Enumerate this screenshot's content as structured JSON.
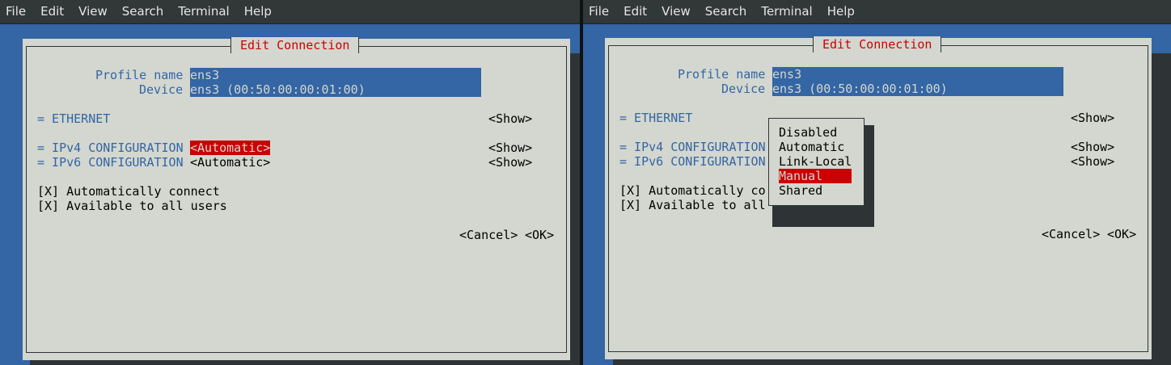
{
  "menubar": {
    "items": [
      "File",
      "Edit",
      "View",
      "Search",
      "Terminal",
      "Help"
    ]
  },
  "dialog": {
    "title": "Edit Connection",
    "profile_label": "Profile name",
    "profile_value": "ens3",
    "device_label": "Device",
    "device_value": "ens3 (00:50:00:00:01:00)",
    "ethernet_label": "= ETHERNET",
    "ipv4_label": "= IPv4 CONFIGURATION",
    "ipv4_value": "<Automatic>",
    "ipv6_label": "= IPv6 CONFIGURATION",
    "ipv6_value": "<Automatic>",
    "show_label": "<Show>",
    "auto_connect": "[X] Automatically connect",
    "all_users": "[X] Available to all users",
    "auto_connect_cut": "[X] Automatically co",
    "all_users_cut": "[X] Available to all",
    "cancel": "<Cancel>",
    "ok": "<OK>"
  },
  "popup": {
    "options": [
      "Disabled",
      "Automatic",
      "Link-Local",
      "Manual",
      "Shared"
    ],
    "selected": "Manual"
  },
  "colors": {
    "terminal_bg": "#3465a4",
    "dialog_bg": "#d3d7cf",
    "accent_red": "#cc0000",
    "label_blue": "#3465a4"
  }
}
